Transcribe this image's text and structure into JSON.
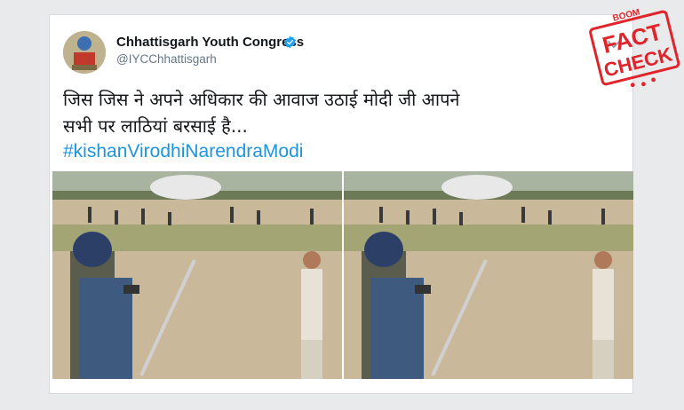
{
  "tweet": {
    "author_name": "Chhattisgarh Youth Congress",
    "handle": "@IYCChhattisgarh",
    "text_line1": "जिस जिस ने अपने अधिकार की आवाज उठाई मोदी जी आपने",
    "text_line2": "सभी पर लाठियां बरसाई है...",
    "hashtag": "#kishanVirodhiNarendraModi"
  },
  "stamp": {
    "brand": "BOOM",
    "word1": "FACT",
    "word2": "CHECK",
    "color": "#e0242b"
  },
  "colors": {
    "hashtag": "#1b95e0",
    "verified": "#1da1f2",
    "handle": "#657786"
  },
  "icons": [
    "verified-badge-icon",
    "chevron-down-icon"
  ]
}
